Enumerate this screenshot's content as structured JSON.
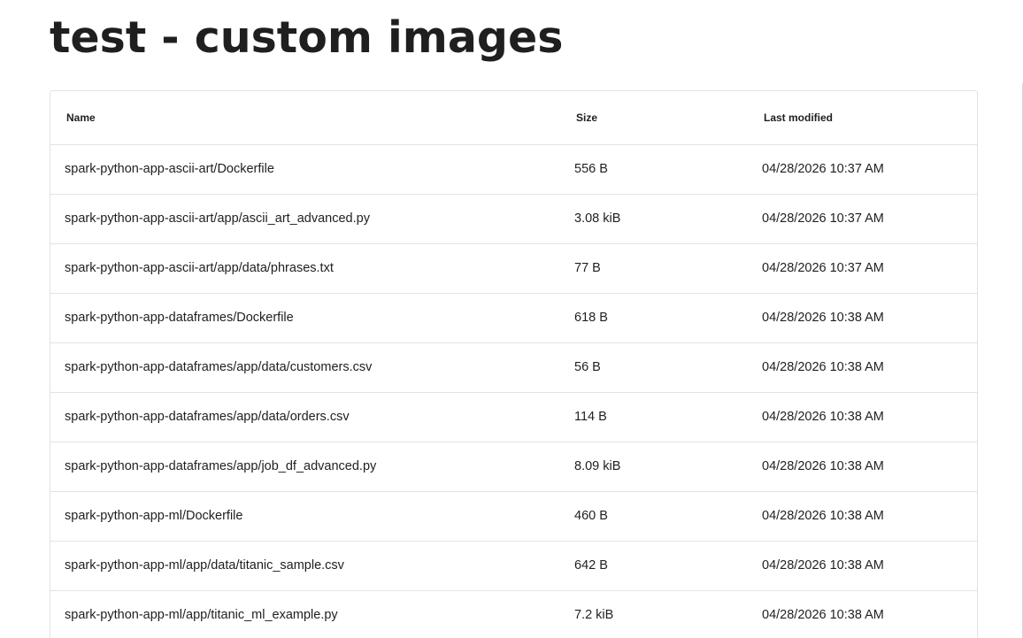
{
  "page": {
    "title": "test - custom images"
  },
  "table": {
    "columns": {
      "name": "Name",
      "size": "Size",
      "modified": "Last modified"
    },
    "rows": [
      {
        "name": "spark-python-app-ascii-art/Dockerfile",
        "size": "556 B",
        "modified": "04/28/2026 10:37 AM"
      },
      {
        "name": "spark-python-app-ascii-art/app/ascii_art_advanced.py",
        "size": "3.08 kiB",
        "modified": "04/28/2026 10:37 AM"
      },
      {
        "name": "spark-python-app-ascii-art/app/data/phrases.txt",
        "size": "77 B",
        "modified": "04/28/2026 10:37 AM"
      },
      {
        "name": "spark-python-app-dataframes/Dockerfile",
        "size": "618 B",
        "modified": "04/28/2026 10:38 AM"
      },
      {
        "name": "spark-python-app-dataframes/app/data/customers.csv",
        "size": "56 B",
        "modified": "04/28/2026 10:38 AM"
      },
      {
        "name": "spark-python-app-dataframes/app/data/orders.csv",
        "size": "114 B",
        "modified": "04/28/2026 10:38 AM"
      },
      {
        "name": "spark-python-app-dataframes/app/job_df_advanced.py",
        "size": "8.09 kiB",
        "modified": "04/28/2026 10:38 AM"
      },
      {
        "name": "spark-python-app-ml/Dockerfile",
        "size": "460 B",
        "modified": "04/28/2026 10:38 AM"
      },
      {
        "name": "spark-python-app-ml/app/data/titanic_sample.csv",
        "size": "642 B",
        "modified": "04/28/2026 10:38 AM"
      },
      {
        "name": "spark-python-app-ml/app/titanic_ml_example.py",
        "size": "7.2 kiB",
        "modified": "04/28/2026 10:38 AM"
      }
    ]
  }
}
